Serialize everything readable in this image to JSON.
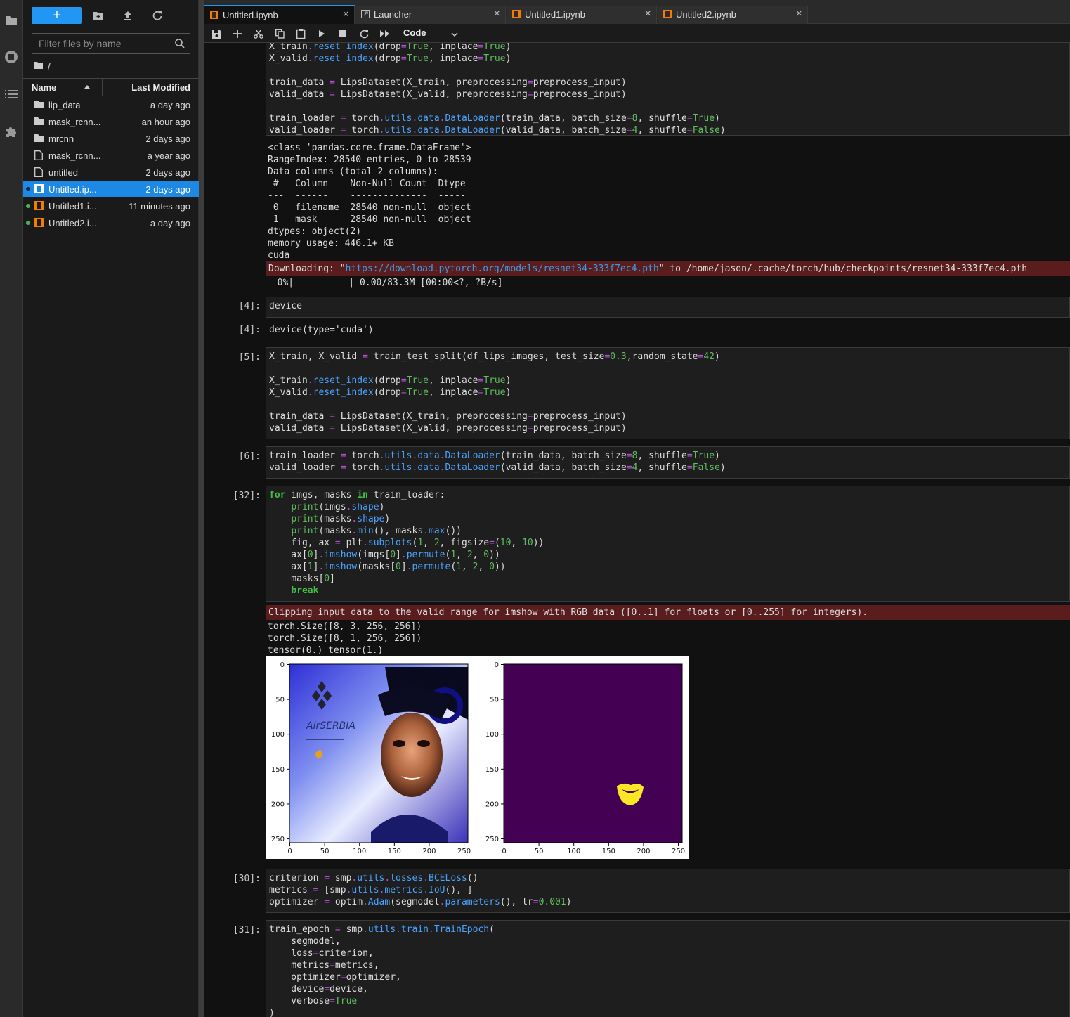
{
  "sidebar": {
    "filter_placeholder": "Filter files by name",
    "breadcrumb": "/",
    "columns": {
      "name": "Name",
      "modified": "Last Modified"
    },
    "files": [
      {
        "name": "lip_data",
        "modified": "a day ago",
        "type": "folder-icon",
        "running": false,
        "selected": false
      },
      {
        "name": "mask_rcnn...",
        "modified": "an hour ago",
        "type": "folder-icon",
        "running": false,
        "selected": false
      },
      {
        "name": "mrcnn",
        "modified": "2 days ago",
        "type": "folder-icon",
        "running": false,
        "selected": false
      },
      {
        "name": "mask_rcnn...",
        "modified": "a year ago",
        "type": "file-icon",
        "running": false,
        "selected": false
      },
      {
        "name": "untitled",
        "modified": "2 days ago",
        "type": "file-icon",
        "running": false,
        "selected": false
      },
      {
        "name": "Untitled.ip...",
        "modified": "2 days ago",
        "type": "notebook-icon",
        "running": true,
        "selected": true
      },
      {
        "name": "Untitled1.i...",
        "modified": "11 minutes ago",
        "type": "notebook-icon",
        "running": true,
        "selected": false
      },
      {
        "name": "Untitled2.i...",
        "modified": "a day ago",
        "type": "notebook-icon",
        "running": true,
        "selected": false
      }
    ]
  },
  "tabs": [
    {
      "label": "Untitled.ipynb",
      "active": true,
      "icon": "notebook-icon"
    },
    {
      "label": "Launcher",
      "active": false,
      "icon": "launcher-icon"
    },
    {
      "label": "Untitled1.ipynb",
      "active": false,
      "icon": "notebook-icon"
    },
    {
      "label": "Untitled2.ipynb",
      "active": false,
      "icon": "notebook-icon"
    }
  ],
  "toolbar": {
    "cell_type": "Code"
  },
  "cells": {
    "c4_prompt": "[4]:",
    "c4_code": "device",
    "o4_prompt": "[4]:",
    "o4_text": "device(type='cuda')",
    "c5_prompt": "[5]:",
    "c6_prompt": "[6]:",
    "c32_prompt": "[32]:",
    "c30_prompt": "[30]:",
    "c31_prompt": "[31]:"
  },
  "outputs": {
    "info": "<class 'pandas.core.frame.DataFrame'>\nRangeIndex: 28540 entries, 0 to 28539\nData columns (total 2 columns):\n #   Column    Non-Null Count  Dtype \n---  ------    --------------  ----- \n 0   filename  28540 non-null  object\n 1   mask      28540 non-null  object\ndtypes: object(2)\nmemory usage: 446.1+ KB\ncuda",
    "download_prefix": "Downloading: \"",
    "download_url": "https://download.pytorch.org/models/resnet34-333f7ec4.pth",
    "download_suffix": "\" to /home/jason/.cache/torch/hub/checkpoints/resnet34-333f7ec4.pth",
    "progress": "  0%|          | 0.00/83.3M [00:00<?, ?B/s]",
    "clip_warning": "Clipping input data to the valid range for imshow with RGB data ([0..1] for floats or [0..255] for integers).",
    "shapes": "torch.Size([8, 3, 256, 256])\ntorch.Size([8, 1, 256, 256])\ntensor(0.) tensor(1.)"
  },
  "figure": {
    "ticks_y": [
      "0",
      "50",
      "100",
      "150",
      "200",
      "250"
    ],
    "ticks_x": [
      "0",
      "50",
      "100",
      "150",
      "200",
      "250"
    ],
    "image_text": "AirSERBIA",
    "colors": {
      "mask_bg": "#440154",
      "mask_fg": "#fde725"
    }
  }
}
